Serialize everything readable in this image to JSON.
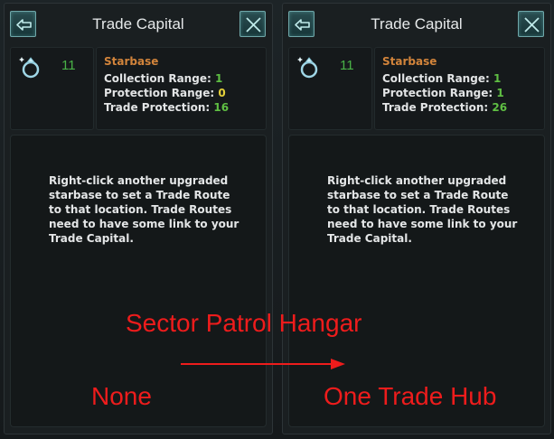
{
  "panels": [
    {
      "title": "Trade Capital",
      "level": "11",
      "info_title": "Starbase",
      "stats": [
        {
          "label": "Collection Range:",
          "value": "1"
        },
        {
          "label": "Protection Range:",
          "value": "0"
        },
        {
          "label": "Trade Protection:",
          "value": "16"
        }
      ],
      "description": "Right-click another upgraded starbase to set a Trade Route to that location. Trade Routes need to have some link to your Trade Capital."
    },
    {
      "title": "Trade Capital",
      "level": "11",
      "info_title": "Starbase",
      "stats": [
        {
          "label": "Collection Range:",
          "value": "1"
        },
        {
          "label": "Protection Range:",
          "value": "1"
        },
        {
          "label": "Trade Protection:",
          "value": "26"
        }
      ],
      "description": "Right-click another upgraded starbase to set a Trade Route to that location. Trade Routes need to have some link to your Trade Capital."
    }
  ],
  "icons": {
    "back": "back-arrow-icon",
    "close": "close-x-icon",
    "starbase": "ring-icon"
  },
  "colors": {
    "accent_orange": "#d2843b",
    "value_green": "#5fbf43",
    "value_yellow": "#e5d13a",
    "annotation_red": "#ee1c1c"
  },
  "annotation": {
    "heading": "Sector Patrol Hangar",
    "before": "None",
    "after": "One Trade Hub"
  }
}
